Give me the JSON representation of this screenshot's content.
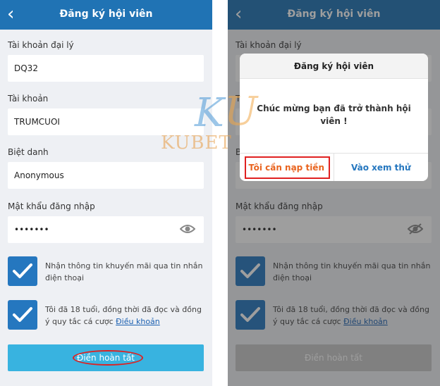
{
  "left": {
    "title": "Đăng ký hội viên",
    "back_icon": "‹",
    "fields": [
      {
        "label": "Tài khoản đại lý",
        "value": "DQ32"
      },
      {
        "label": "Tài khoản",
        "value": "TRUMCUOI"
      },
      {
        "label": "Biệt danh",
        "value": "Anonymous"
      },
      {
        "label": "Mật khẩu đăng nhập",
        "value": "•••••••"
      }
    ],
    "checkbox1_text": "Nhận thông tin khuyến mãi qua tin nhắn điện thoại",
    "checkbox2_text": "Tôi đã 18 tuổi, đồng thời đã đọc và đồng ý quy tắc cá cược",
    "terms_link": "Điều khoản",
    "submit_label": "Điền hoàn tất"
  },
  "right": {
    "title": "Đăng ký hội viên",
    "back_icon": "‹",
    "fields": [
      {
        "label": "Tài khoản đại lý",
        "value": ""
      },
      {
        "label": "T",
        "value": ""
      },
      {
        "label": "B",
        "value": ""
      },
      {
        "label": "Mật khẩu đăng nhập",
        "value": "•••••••"
      }
    ],
    "checkbox1_text": "Nhận thông tin khuyến mãi qua tin nhắn điện thoại",
    "checkbox2_text": "Tôi đã 18 tuổi, đồng thời đã đọc và đồng ý quy tắc cá cược",
    "terms_link": "Điều khoản",
    "submit_label": "Điền hoàn tất",
    "dialog": {
      "title": "Đăng ký hội viên",
      "message": "Chúc mừng bạn đã trở thành hội viên !",
      "button_deposit": "Tôi cần nạp tiền",
      "button_view": "Vào xem thử"
    }
  },
  "watermark": {
    "k": "K",
    "u": "U",
    "text": "KUBET"
  },
  "colors": {
    "header": "#2073b4",
    "checkbox": "#2577bf",
    "submit": "#38b3e0",
    "highlight": "#e02020",
    "deposit": "#e9641f"
  }
}
